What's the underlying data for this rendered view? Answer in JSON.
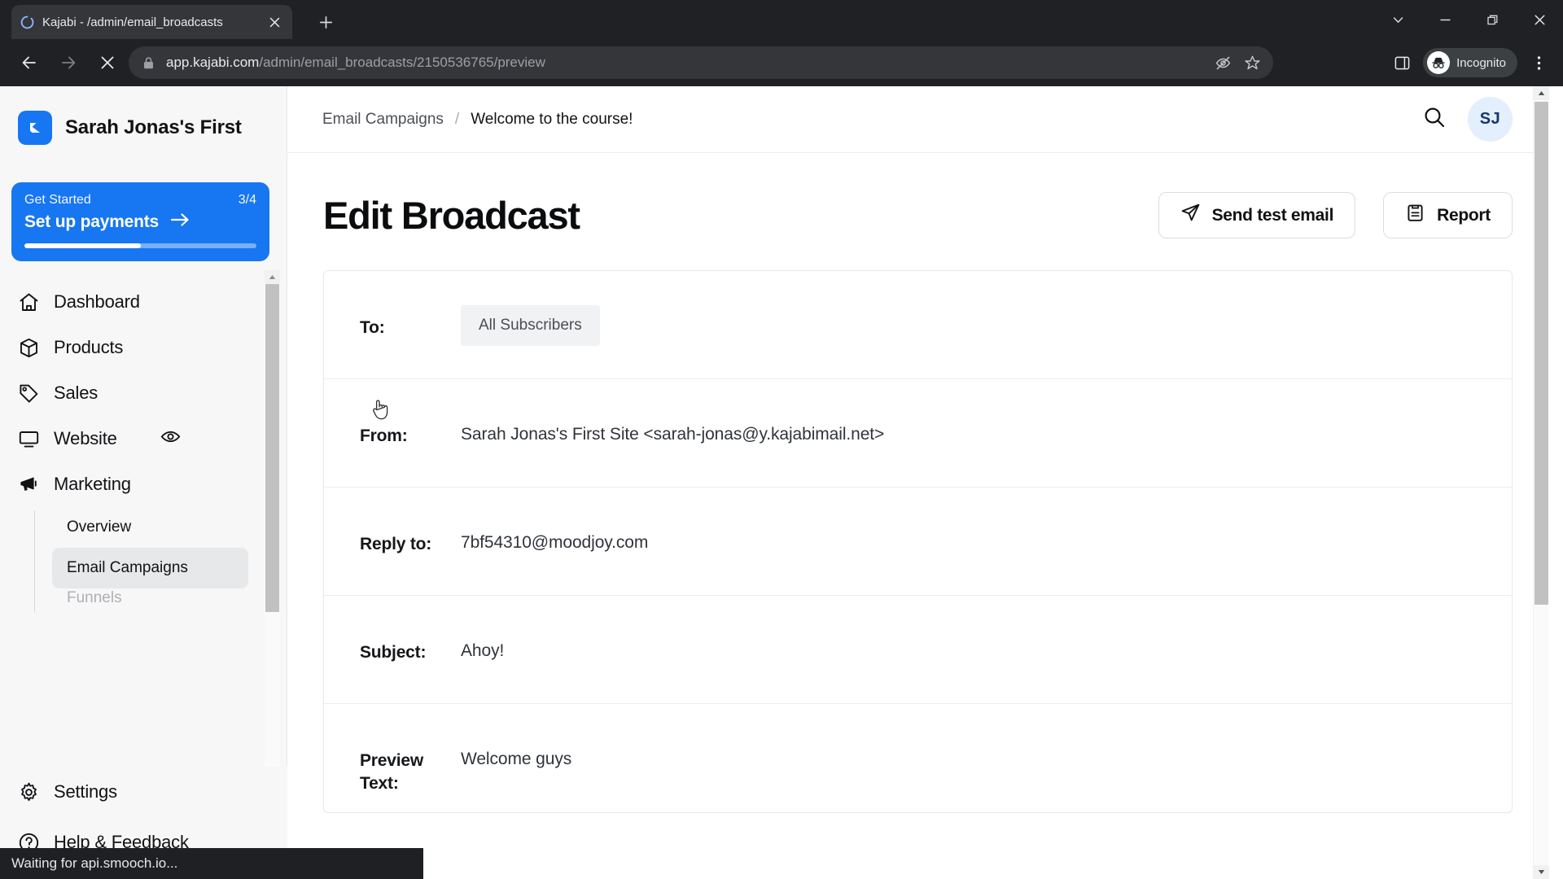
{
  "browser": {
    "tab": {
      "title": "Kajabi - /admin/email_broadcasts",
      "favicon_icon": "kajabi-loading-spinner-icon",
      "close_icon": "close-icon"
    },
    "new_tab_icon": "plus-icon",
    "window_controls": {
      "tab_search_icon": "chevron-down-icon",
      "minimize_icon": "minimize-icon",
      "maximize_icon": "restore-window-icon",
      "close_icon": "close-icon"
    },
    "toolbar": {
      "back_icon": "arrow-left-icon",
      "forward_icon": "arrow-right-icon",
      "stop_icon": "stop-loading-icon",
      "lock_icon": "lock-icon",
      "url_domain": "app.kajabi.com",
      "url_path": "/admin/email_broadcasts/2150536765/preview",
      "url_full": "app.kajabi.com/admin/email_broadcasts/2150536765/preview",
      "third_party_cookie_icon": "eye-slash-icon",
      "bookmark_icon": "star-icon",
      "side_panel_icon": "side-panel-icon",
      "incognito_icon": "incognito-hat-glasses-icon",
      "incognito_label": "Incognito",
      "menu_icon": "kebab-menu-icon"
    }
  },
  "sidebar": {
    "brand": {
      "logo_icon": "kajabi-logo-icon",
      "name": "Sarah Jonas's First",
      "logo_color": "#1776f2"
    },
    "get_started": {
      "label": "Get Started",
      "count": "3/4",
      "cta": "Set up payments",
      "cta_icon": "arrow-right-icon",
      "progress_percent": 50,
      "background_color": "#1776f2"
    },
    "items": [
      {
        "label": "Dashboard",
        "icon": "home-icon"
      },
      {
        "label": "Products",
        "icon": "box-icon"
      },
      {
        "label": "Sales",
        "icon": "tag-icon"
      },
      {
        "label": "Website",
        "icon": "monitor-icon",
        "trailing_icon": "eye-icon"
      },
      {
        "label": "Marketing",
        "icon": "megaphone-icon"
      }
    ],
    "marketing_subitems": [
      {
        "label": "Overview",
        "active": false
      },
      {
        "label": "Email Campaigns",
        "active": true
      },
      {
        "label": "Funnels",
        "active": false
      }
    ],
    "bottom_items": [
      {
        "label": "Settings",
        "icon": "gear-icon"
      },
      {
        "label": "Help & Feedback",
        "icon": "question-circle-icon"
      }
    ],
    "scrollbar": {
      "up_icon": "scroll-up-arrow",
      "down_icon": "scroll-down-arrow"
    }
  },
  "main": {
    "breadcrumb": {
      "parent": "Email Campaigns",
      "separator": "/",
      "current": "Welcome to the course!"
    },
    "search_icon": "search-icon",
    "avatar_initials": "SJ",
    "avatar_bg": "#e3effd",
    "page_title": "Edit Broadcast",
    "actions": [
      {
        "label": "Send test email",
        "icon": "paper-plane-icon"
      },
      {
        "label": "Report",
        "icon": "clipboard-icon"
      }
    ],
    "fields": [
      {
        "label": "To:",
        "value": "All Subscribers",
        "type": "chip"
      },
      {
        "label": "From:",
        "value": "Sarah Jonas's First Site <sarah-jonas@y.kajabimail.net>",
        "type": "text"
      },
      {
        "label": "Reply to:",
        "value": "7bf54310@moodjoy.com",
        "type": "text"
      },
      {
        "label": "Subject:",
        "value": "Ahoy!",
        "type": "text"
      },
      {
        "label": "Preview Text:",
        "value": "Welcome guys",
        "type": "text"
      }
    ],
    "scrollbar": {
      "up_icon": "scroll-up-arrow",
      "down_icon": "scroll-down-arrow"
    }
  },
  "status_bar": {
    "text": "Waiting for api.smooch.io..."
  }
}
